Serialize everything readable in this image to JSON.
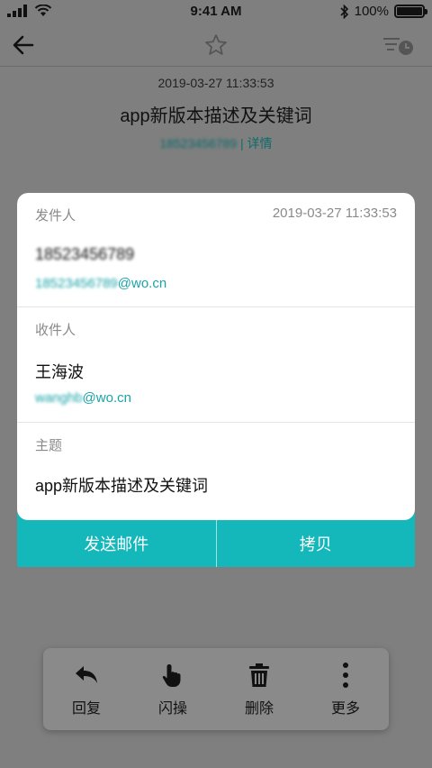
{
  "status_bar": {
    "time": "9:41 AM",
    "battery": "100%"
  },
  "mail": {
    "date": "2019-03-27 11:33:53",
    "title": "app新版本描述及关键词",
    "sender_blurred": "18523456789",
    "detail_link": "详情",
    "separator": "|"
  },
  "dialog": {
    "sender": {
      "label": "发件人",
      "time": "2019-03-27 11:33:53",
      "name": "18523456789",
      "email_local": "18523456789",
      "email_domain": "@wo.cn"
    },
    "recipient": {
      "label": "收件人",
      "name": "王海波",
      "email_local": "wanghb",
      "email_domain": "@wo.cn"
    },
    "subject": {
      "label": "主题",
      "value": "app新版本描述及关键词"
    },
    "actions": {
      "send": "发送邮件",
      "copy": "拷贝"
    }
  },
  "toolbar": {
    "reply": "回复",
    "flash": "闪操",
    "delete": "删除",
    "more": "更多"
  },
  "colors": {
    "accent": "#14b8ba",
    "link": "#1aa3a8",
    "overlay": "#7f7f7f"
  }
}
